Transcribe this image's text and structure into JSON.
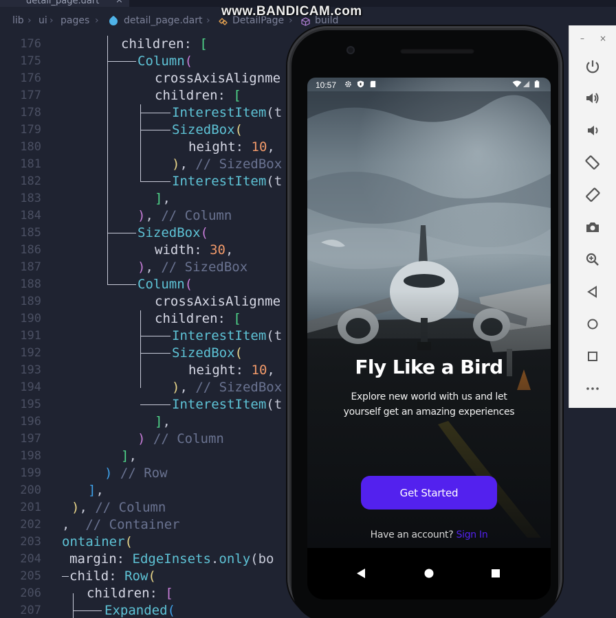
{
  "watermark": "www.BANDICAM.com",
  "editor": {
    "tab": {
      "file": "detail_page.dart",
      "close": "×"
    },
    "breadcrumb": {
      "parts": [
        "lib",
        "ui",
        "pages",
        "detail_page.dart",
        "DetailPage",
        "build"
      ],
      "sep": "›"
    },
    "line_numbers": [
      "176",
      "175",
      "176",
      "177",
      "178",
      "179",
      "180",
      "181",
      "182",
      "183",
      "184",
      "185",
      "186",
      "187",
      "188",
      "189",
      "190",
      "191",
      "192",
      "193",
      "194",
      "195",
      "196",
      "197",
      "198",
      "199",
      "200",
      "201",
      "202",
      "203",
      "204",
      "205",
      "206",
      "207"
    ],
    "lines": [
      {
        "a": "children",
        "b": ": ",
        "c": "["
      },
      {
        "a": "Column",
        "b": "("
      },
      {
        "a": "crossAxisAlignme"
      },
      {
        "a": "children",
        "b": ": ",
        "c": "["
      },
      {
        "a": "InterestItem",
        "b": "(t"
      },
      {
        "a": "SizedBox",
        "b": "("
      },
      {
        "a": "height",
        "b": ": ",
        "c": "10",
        "d": ","
      },
      {
        "a": ")",
        "b": ", ",
        "c": "// SizedBox"
      },
      {
        "a": "InterestItem",
        "b": "(t"
      },
      {
        "a": "]",
        "b": ","
      },
      {
        "a": ")",
        "b": ", ",
        "c": "// Column"
      },
      {
        "a": "SizedBox",
        "b": "("
      },
      {
        "a": "width",
        "b": ": ",
        "c": "30",
        "d": ","
      },
      {
        "a": ")",
        "b": ", ",
        "c": "// SizedBox"
      },
      {
        "a": "Column",
        "b": "("
      },
      {
        "a": "crossAxisAlignme"
      },
      {
        "a": "children",
        "b": ": ",
        "c": "["
      },
      {
        "a": "InterestItem",
        "b": "(t"
      },
      {
        "a": "SizedBox",
        "b": "("
      },
      {
        "a": "height",
        "b": ": ",
        "c": "10",
        "d": ","
      },
      {
        "a": ")",
        "b": ", ",
        "c": "// SizedBox"
      },
      {
        "a": "InterestItem",
        "b": "(t"
      },
      {
        "a": "]",
        "b": ","
      },
      {
        "a": ")",
        "b": " ",
        "c": "// Column"
      },
      {
        "a": "]",
        "b": ","
      },
      {
        "a": ")",
        "b": " ",
        "c": "// Row"
      },
      {
        "a": "]",
        "b": ","
      },
      {
        "a": ")",
        "b": ", ",
        "c": "// Column"
      },
      {
        "a": ",",
        "b": "  ",
        "c": "// Container"
      },
      {
        "a": "ontainer",
        "b": "("
      },
      {
        "a": "margin",
        "b": ": ",
        "c": "EdgeInsets",
        "d": ".",
        "e": "only",
        "f": "(bo"
      },
      {
        "a": "child",
        "b": ": ",
        "c": "Row",
        "d": "("
      },
      {
        "a": "children",
        "b": ": ",
        "c": "["
      },
      {
        "a": "Expanded",
        "b": "("
      }
    ]
  },
  "phone": {
    "status": {
      "time": "10:57"
    },
    "headline": "Fly Like a Bird",
    "subtitle": [
      "Explore new world with us and let",
      "yourself get an amazing experiences"
    ],
    "cta": "Get Started",
    "signin_prompt": "Have an account?",
    "signin_link": "Sign In",
    "colors": {
      "accent": "#5321EE"
    }
  },
  "emulator": {
    "minimize": "–",
    "close": "×"
  }
}
